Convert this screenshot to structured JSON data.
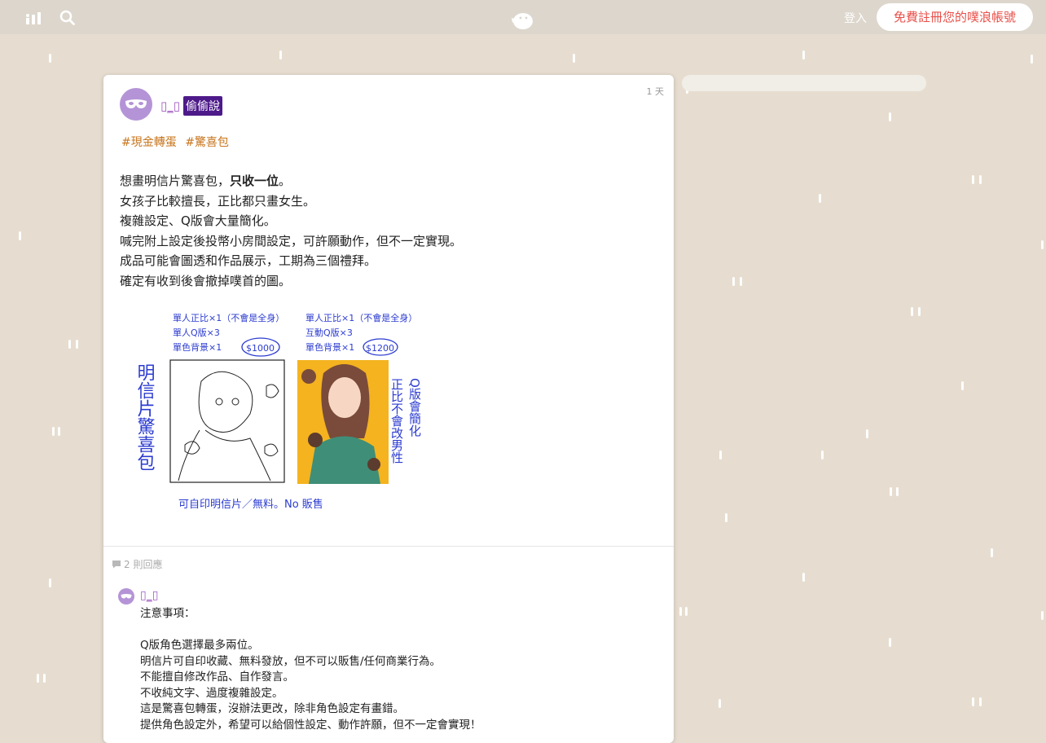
{
  "topbar": {
    "login_label": "登入",
    "register_label": "免費註冊您的噗浪帳號",
    "icons": [
      "chart-icon",
      "search-icon",
      "plurk-logo"
    ]
  },
  "post": {
    "time": "1 天",
    "username": "▯_▯",
    "qualifier": "偷偷說",
    "tags": [
      "#現金轉蛋",
      "#驚喜包"
    ],
    "lines": [
      {
        "before": "想畫明信片驚喜包，",
        "bold": "只收一位",
        "after": "。"
      },
      {
        "text": "女孩子比較擅長，正比都只畫女生。"
      },
      {
        "text": "複雜設定、Q版會大量簡化。"
      },
      {
        "text": "喊完附上設定後投幣小房間設定，可許願動作，但不一定實現。"
      },
      {
        "text": "成品可能會圖透和作品展示，工期為三個禮拜。"
      },
      {
        "text": "確定有收到後會撤掉噗首的圖。"
      }
    ],
    "image": {
      "left_caption": [
        "單人正比×1（不會是全身）",
        "單人Q版×3",
        "單色背景×1"
      ],
      "left_price": "$1000",
      "right_caption": [
        "單人正比×1（不會是全身）",
        "互動Q版×3",
        "單色背景×1"
      ],
      "right_price": "$1200",
      "vertical_left": "明信片驚喜包",
      "vertical_right_1": "正比不會改男性",
      "vertical_right_2": "Q版會簡化",
      "bottom_caption": "可自印明信片／無料。No 販售"
    }
  },
  "responses": {
    "count_label": "2 則回應",
    "first": {
      "username": "▯_▯",
      "lines": [
        "注意事項：",
        "",
        "Q版角色選擇最多兩位。",
        "明信片可自印收藏、無料發放，但不可以販售/任何商業行為。",
        "不能擅自修改作品、自作發言。",
        "不收純文字、過度複雜設定。",
        "這是驚喜包轉蛋，沒辦法更改，除非角色設定有畫錯。",
        "提供角色設定外，希望可以給個性設定、動作許願，但不一定會實現！"
      ]
    }
  },
  "colors": {
    "background": "#e6ddd0",
    "accent": "#e8504a",
    "username": "#a05ac0",
    "qualifier": "#4d1a8a",
    "tag": "#c8751d"
  }
}
